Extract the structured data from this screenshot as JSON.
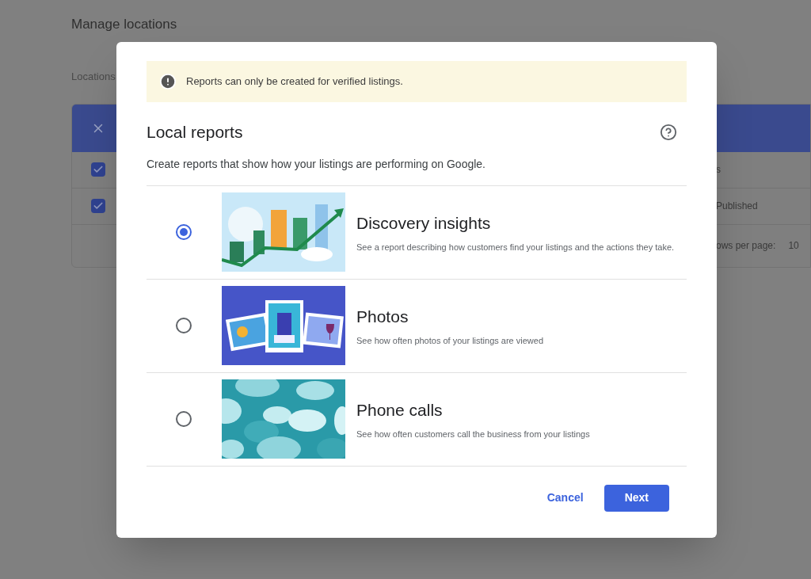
{
  "page": {
    "title": "Manage locations",
    "section_label": "Locations",
    "table": {
      "rows": [
        {
          "checked": true,
          "text": "s"
        },
        {
          "checked": true,
          "text": "Published"
        }
      ],
      "footer": {
        "rows_label": "ows per page:",
        "rows_value": "10"
      }
    }
  },
  "dialog": {
    "banner": "Reports can only be created for verified listings.",
    "title": "Local reports",
    "description": "Create reports that show how your listings are performing on Google.",
    "options": [
      {
        "selected": true,
        "title": "Discovery insights",
        "description": "See a report describing how customers find your listings and the actions they take.",
        "kind": "picture"
      },
      {
        "selected": false,
        "title": "Photos",
        "description": "See how often photos of your listings are viewed",
        "kind": "picture"
      },
      {
        "selected": false,
        "title": "Phone calls",
        "description": "See how often customers call the business from your listings",
        "kind": "picture"
      }
    ],
    "buttons": [
      {
        "label": "Cancel",
        "kind": "text"
      },
      {
        "label": "Next",
        "kind": "primary"
      }
    ]
  }
}
